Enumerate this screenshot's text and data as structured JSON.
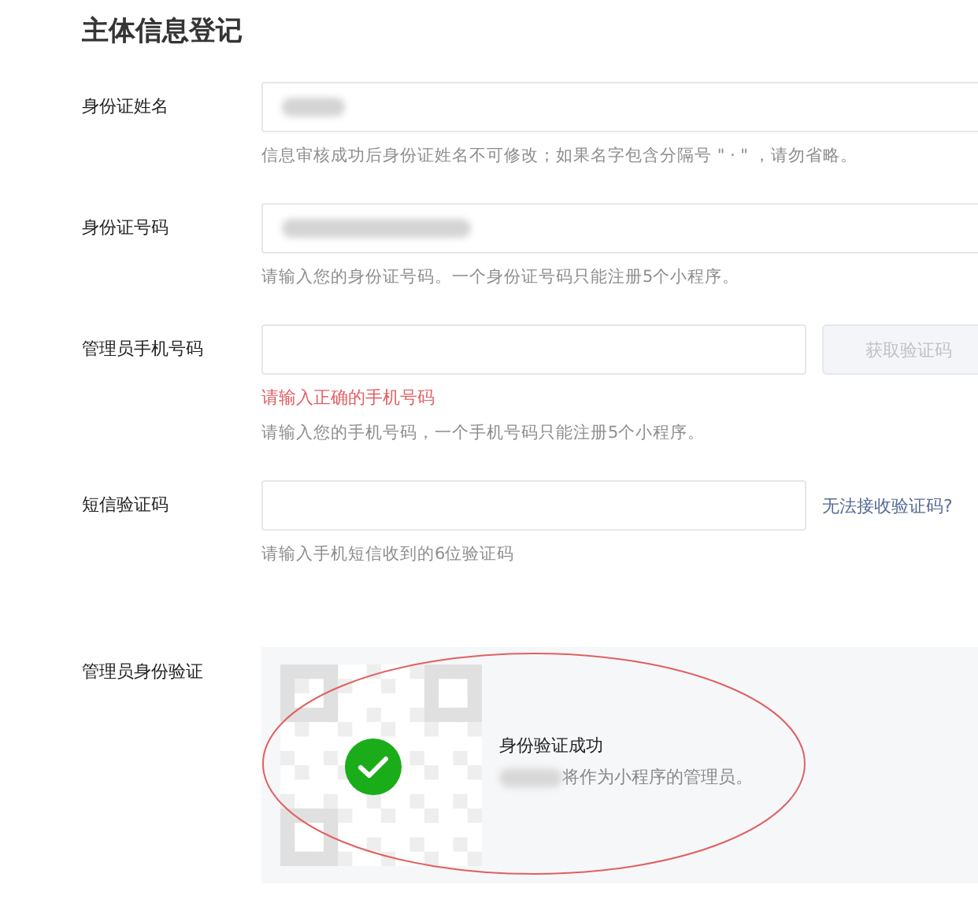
{
  "title": "主体信息登记",
  "fields": [
    {
      "kind": "input",
      "label": "身份证姓名",
      "redacted": true,
      "hint": "信息审核成功后身份证姓名不可修改；如果名字包含分隔号 \" · \" ，请勿省略。"
    },
    {
      "kind": "input",
      "label": "身份证号码",
      "redacted": true,
      "hint": "请输入您的身份证号码。一个身份证号码只能注册5个小程序。"
    },
    {
      "kind": "input-button",
      "label": "管理员手机号码",
      "redacted": false,
      "button": {
        "label": "获取验证码",
        "disabled": true
      },
      "error": "请输入正确的手机号码",
      "hint": "请输入您的手机号码，一个手机号码只能注册5个小程序。"
    },
    {
      "kind": "input-link",
      "label": "短信验证码",
      "redacted": false,
      "link": "无法接收验证码?",
      "hint": "请输入手机短信收到的6位验证码"
    }
  ],
  "verification": {
    "label": "管理员身份验证",
    "verified": true,
    "status": "身份验证成功",
    "message": "将作为小程序的管理员。",
    "annotated": true
  }
}
